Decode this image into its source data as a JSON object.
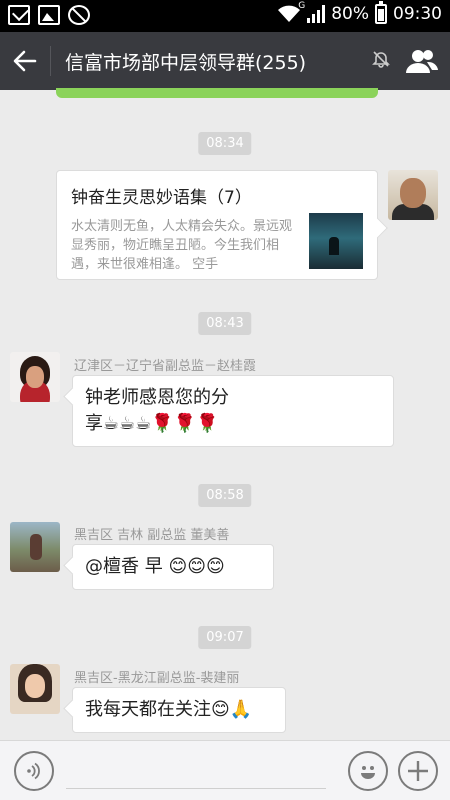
{
  "status_bar": {
    "network_type": "G",
    "battery": "80%",
    "time": "09:30",
    "icons": [
      "mail-icon",
      "image-icon",
      "block-icon",
      "wifi-icon",
      "signal-icon",
      "battery-icon"
    ]
  },
  "title_bar": {
    "back_icon": "back-arrow-icon",
    "title": "信富市场部中层领导群(255)",
    "mute_icon": "mute-icon",
    "members_icon": "members-icon",
    "background": "#393a3f"
  },
  "messages": [
    {
      "type": "time",
      "text": "08:34"
    },
    {
      "type": "link_card",
      "from_me": true,
      "title": "钟奋生灵思妙语集（7）",
      "description": "水太清则无鱼，人太精会失众。景远观显秀丽，物近瞧呈丑陋。今生我们相遇，来世很难相逢。 空手"
    },
    {
      "type": "time",
      "text": "08:43"
    },
    {
      "type": "text",
      "sender": "辽津区－辽宁省副总监－赵桂霞",
      "line1": "钟老师感恩您的分",
      "line2": "享☕☕☕🌹🌹🌹"
    },
    {
      "type": "time",
      "text": "08:58"
    },
    {
      "type": "text",
      "sender": "黑吉区 吉林 副总监  董美善",
      "line1": "@檀香  早 😊😊😊"
    },
    {
      "type": "time",
      "text": "09:07"
    },
    {
      "type": "text",
      "sender": "黑吉区-黑龙江副总监-裴建丽",
      "line1": "我每天都在关注😊🙏"
    }
  ],
  "input_bar": {
    "voice_icon": "voice-icon",
    "emoji_icon": "emoji-icon",
    "plus_icon": "plus-icon"
  }
}
